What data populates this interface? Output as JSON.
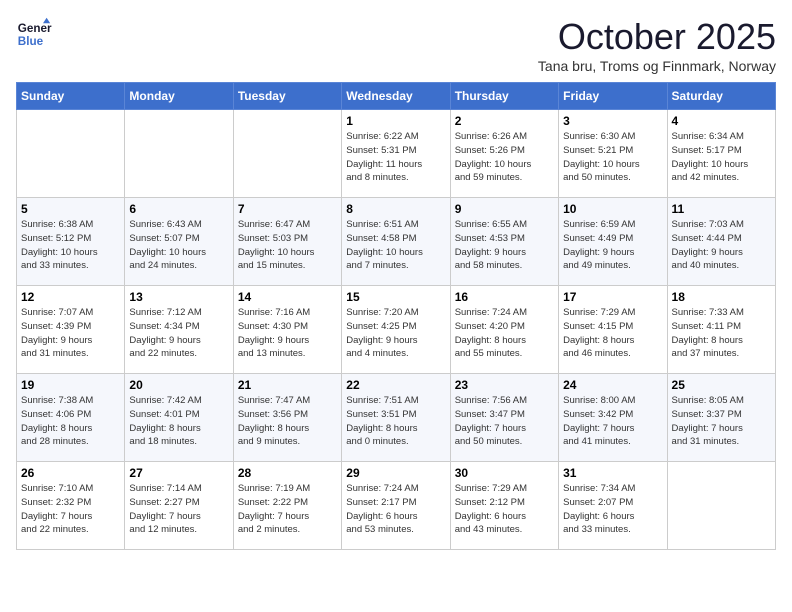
{
  "header": {
    "logo_line1": "General",
    "logo_line2": "Blue",
    "month": "October 2025",
    "location": "Tana bru, Troms og Finnmark, Norway"
  },
  "days_of_week": [
    "Sunday",
    "Monday",
    "Tuesday",
    "Wednesday",
    "Thursday",
    "Friday",
    "Saturday"
  ],
  "weeks": [
    [
      {
        "day": "",
        "info": ""
      },
      {
        "day": "",
        "info": ""
      },
      {
        "day": "",
        "info": ""
      },
      {
        "day": "1",
        "info": "Sunrise: 6:22 AM\nSunset: 5:31 PM\nDaylight: 11 hours\nand 8 minutes."
      },
      {
        "day": "2",
        "info": "Sunrise: 6:26 AM\nSunset: 5:26 PM\nDaylight: 10 hours\nand 59 minutes."
      },
      {
        "day": "3",
        "info": "Sunrise: 6:30 AM\nSunset: 5:21 PM\nDaylight: 10 hours\nand 50 minutes."
      },
      {
        "day": "4",
        "info": "Sunrise: 6:34 AM\nSunset: 5:17 PM\nDaylight: 10 hours\nand 42 minutes."
      }
    ],
    [
      {
        "day": "5",
        "info": "Sunrise: 6:38 AM\nSunset: 5:12 PM\nDaylight: 10 hours\nand 33 minutes."
      },
      {
        "day": "6",
        "info": "Sunrise: 6:43 AM\nSunset: 5:07 PM\nDaylight: 10 hours\nand 24 minutes."
      },
      {
        "day": "7",
        "info": "Sunrise: 6:47 AM\nSunset: 5:03 PM\nDaylight: 10 hours\nand 15 minutes."
      },
      {
        "day": "8",
        "info": "Sunrise: 6:51 AM\nSunset: 4:58 PM\nDaylight: 10 hours\nand 7 minutes."
      },
      {
        "day": "9",
        "info": "Sunrise: 6:55 AM\nSunset: 4:53 PM\nDaylight: 9 hours\nand 58 minutes."
      },
      {
        "day": "10",
        "info": "Sunrise: 6:59 AM\nSunset: 4:49 PM\nDaylight: 9 hours\nand 49 minutes."
      },
      {
        "day": "11",
        "info": "Sunrise: 7:03 AM\nSunset: 4:44 PM\nDaylight: 9 hours\nand 40 minutes."
      }
    ],
    [
      {
        "day": "12",
        "info": "Sunrise: 7:07 AM\nSunset: 4:39 PM\nDaylight: 9 hours\nand 31 minutes."
      },
      {
        "day": "13",
        "info": "Sunrise: 7:12 AM\nSunset: 4:34 PM\nDaylight: 9 hours\nand 22 minutes."
      },
      {
        "day": "14",
        "info": "Sunrise: 7:16 AM\nSunset: 4:30 PM\nDaylight: 9 hours\nand 13 minutes."
      },
      {
        "day": "15",
        "info": "Sunrise: 7:20 AM\nSunset: 4:25 PM\nDaylight: 9 hours\nand 4 minutes."
      },
      {
        "day": "16",
        "info": "Sunrise: 7:24 AM\nSunset: 4:20 PM\nDaylight: 8 hours\nand 55 minutes."
      },
      {
        "day": "17",
        "info": "Sunrise: 7:29 AM\nSunset: 4:15 PM\nDaylight: 8 hours\nand 46 minutes."
      },
      {
        "day": "18",
        "info": "Sunrise: 7:33 AM\nSunset: 4:11 PM\nDaylight: 8 hours\nand 37 minutes."
      }
    ],
    [
      {
        "day": "19",
        "info": "Sunrise: 7:38 AM\nSunset: 4:06 PM\nDaylight: 8 hours\nand 28 minutes."
      },
      {
        "day": "20",
        "info": "Sunrise: 7:42 AM\nSunset: 4:01 PM\nDaylight: 8 hours\nand 18 minutes."
      },
      {
        "day": "21",
        "info": "Sunrise: 7:47 AM\nSunset: 3:56 PM\nDaylight: 8 hours\nand 9 minutes."
      },
      {
        "day": "22",
        "info": "Sunrise: 7:51 AM\nSunset: 3:51 PM\nDaylight: 8 hours\nand 0 minutes."
      },
      {
        "day": "23",
        "info": "Sunrise: 7:56 AM\nSunset: 3:47 PM\nDaylight: 7 hours\nand 50 minutes."
      },
      {
        "day": "24",
        "info": "Sunrise: 8:00 AM\nSunset: 3:42 PM\nDaylight: 7 hours\nand 41 minutes."
      },
      {
        "day": "25",
        "info": "Sunrise: 8:05 AM\nSunset: 3:37 PM\nDaylight: 7 hours\nand 31 minutes."
      }
    ],
    [
      {
        "day": "26",
        "info": "Sunrise: 7:10 AM\nSunset: 2:32 PM\nDaylight: 7 hours\nand 22 minutes."
      },
      {
        "day": "27",
        "info": "Sunrise: 7:14 AM\nSunset: 2:27 PM\nDaylight: 7 hours\nand 12 minutes."
      },
      {
        "day": "28",
        "info": "Sunrise: 7:19 AM\nSunset: 2:22 PM\nDaylight: 7 hours\nand 2 minutes."
      },
      {
        "day": "29",
        "info": "Sunrise: 7:24 AM\nSunset: 2:17 PM\nDaylight: 6 hours\nand 53 minutes."
      },
      {
        "day": "30",
        "info": "Sunrise: 7:29 AM\nSunset: 2:12 PM\nDaylight: 6 hours\nand 43 minutes."
      },
      {
        "day": "31",
        "info": "Sunrise: 7:34 AM\nSunset: 2:07 PM\nDaylight: 6 hours\nand 33 minutes."
      },
      {
        "day": "",
        "info": ""
      }
    ]
  ]
}
